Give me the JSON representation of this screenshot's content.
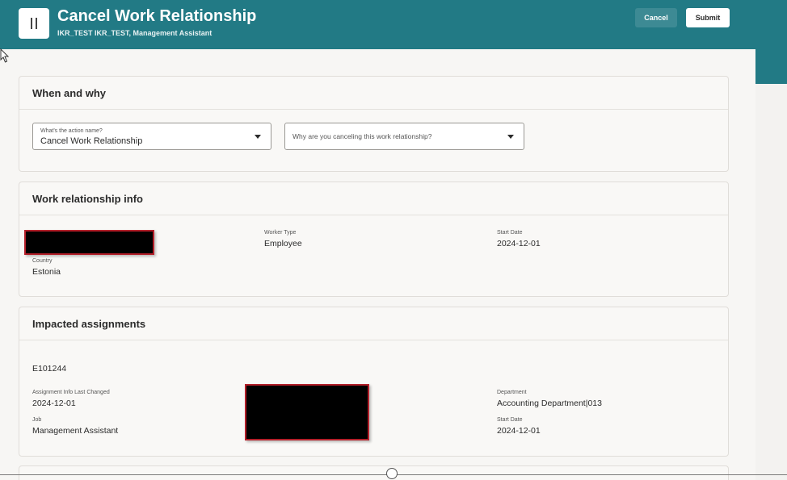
{
  "header": {
    "icon": "panel-toggle-icon",
    "title": "Cancel Work Relationship",
    "subtitle": "IKR_TEST IKR_TEST, Management Assistant",
    "cancel_label": "Cancel",
    "submit_label": "Submit",
    "color": "#227a85"
  },
  "when_why": {
    "title": "When and why",
    "action": {
      "label": "What's the action name?",
      "value": "Cancel Work Relationship"
    },
    "reason": {
      "placeholder": "Why are you canceling this work relationship?"
    }
  },
  "work_info": {
    "title": "Work relationship info",
    "worker_type": {
      "label": "Worker Type",
      "value": "Employee"
    },
    "start_date": {
      "label": "Start Date",
      "value": "2024-12-01"
    },
    "country": {
      "label": "Country",
      "value": "Estonia"
    }
  },
  "impacted": {
    "title": "Impacted assignments",
    "assignment_number": "E101244",
    "last_changed": {
      "label": "Assignment Info Last Changed",
      "value": "2024-12-01"
    },
    "job": {
      "label": "Job",
      "value": "Management Assistant"
    },
    "department": {
      "label": "Department",
      "value": "Accounting Department|013"
    },
    "start_date": {
      "label": "Start Date",
      "value": "2024-12-01"
    }
  }
}
